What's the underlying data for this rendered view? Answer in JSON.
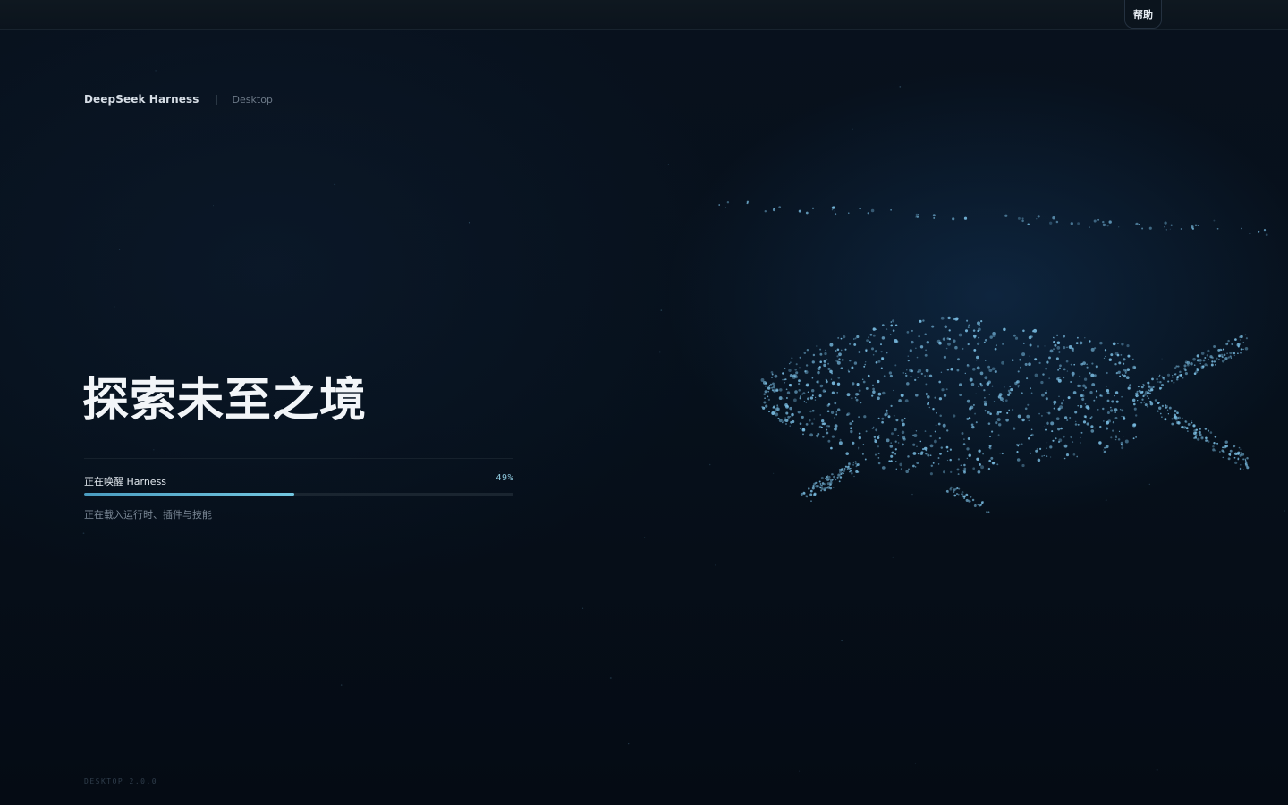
{
  "titlebar": {
    "help_label": "帮助"
  },
  "brand": {
    "name": "DeepSeek Harness",
    "subtitle": "Desktop"
  },
  "hero": {
    "headline": "探索未至之境"
  },
  "loader": {
    "label": "正在唤醒 Harness",
    "percent_text": "49%",
    "progress": 0.49,
    "detail": "正在载入运行时、插件与技能"
  },
  "footer": {
    "version": "DESKTOP 2.0.0"
  },
  "colors": {
    "background": "#060d17",
    "accent": "#73c7e0",
    "particle": "#7fc4ea"
  },
  "icons": {
    "whale": "particle-whale-illustration"
  }
}
